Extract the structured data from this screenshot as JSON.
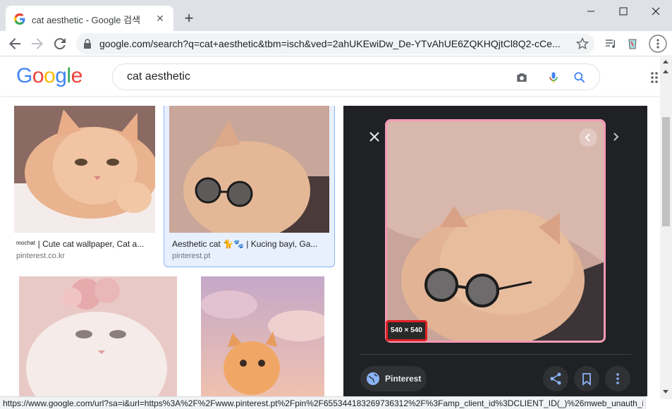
{
  "browser": {
    "tab_title": "cat aesthetic - Google 검색",
    "tab_close": "✕",
    "new_tab": "+",
    "url": "google.com/search?q=cat+aesthetic&tbm=isch&ved=2ahUKEwiDw_De-YTvAhUE6ZQKHQjtCl8Q2-cCe...",
    "status_url": "https://www.google.com/url?sa=i&url=https%3A%2F%2Fwww.pinterest.pt%2Fpin%2F655344183269736312%2F%3Famp_client_id%3DCLIENT_ID(_)%26mweb_unauth_i..."
  },
  "google": {
    "logo_letters": [
      "G",
      "o",
      "o",
      "g",
      "l",
      "e"
    ],
    "logo_colors": [
      "#4285F4",
      "#EA4335",
      "#FBBC05",
      "#4285F4",
      "#34A853",
      "#EA4335"
    ],
    "query": "cat aesthetic"
  },
  "results": [
    {
      "caption": "ᵐᵒᶜʰᵃᵗ | Cute cat wallpaper, Cat a...",
      "source": "pinterest.co.kr"
    },
    {
      "caption": "Aesthetic cat 🐈🐾 | Kucing bayi, Ga...",
      "source": "pinterest.pt"
    }
  ],
  "preview": {
    "dimensions": "540 × 540",
    "site_label": "Pinterest"
  },
  "icons": {
    "close": "close-icon",
    "prev": "chevron-left-icon",
    "next": "chevron-right-icon",
    "share": "share-icon",
    "save": "bookmark-icon",
    "more": "more-vert-icon"
  }
}
